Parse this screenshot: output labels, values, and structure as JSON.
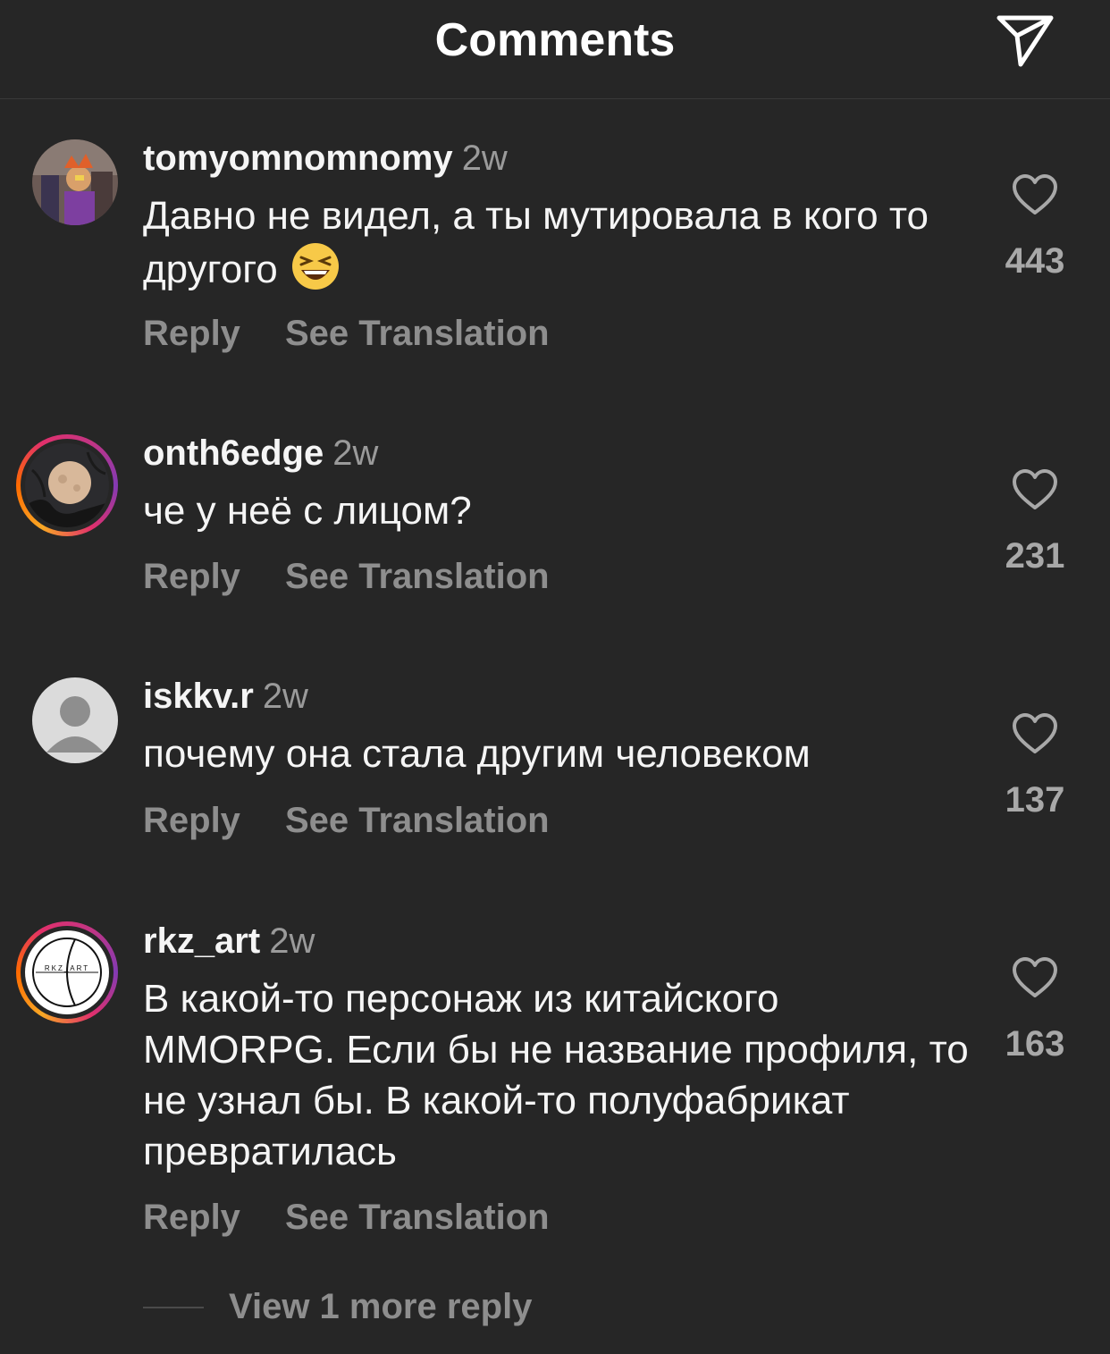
{
  "header": {
    "title": "Comments"
  },
  "comments": [
    {
      "username": "tomyomnomnomy",
      "time": "2w",
      "text": "Давно не видел, а ты мутировала в кого то другого",
      "emoji": "grinning-squinting-face",
      "reply_label": "Reply",
      "translate_label": "See Translation",
      "likes": "443",
      "avatar_ring": false
    },
    {
      "username": "onth6edge",
      "time": "2w",
      "text": "че у неё с лицом?",
      "reply_label": "Reply",
      "translate_label": "See Translation",
      "likes": "231",
      "avatar_ring": true
    },
    {
      "username": "iskkv.r",
      "time": "2w",
      "text": "почему она стала другим человеком",
      "reply_label": "Reply",
      "translate_label": "See Translation",
      "likes": "137",
      "avatar_ring": false
    },
    {
      "username": "rkz_art",
      "time": "2w",
      "text": "В какой-то персонаж из китайского MMORPG. Если бы не название профиля, то не узнал бы. В какой-то полуфабрикат превратилась",
      "reply_label": "Reply",
      "translate_label": "See Translation",
      "likes": "163",
      "avatar_ring": true,
      "avatar_logo_text": "RKZ_ART"
    }
  ],
  "view_more": {
    "label": "View 1 more reply"
  },
  "icons": {
    "share": "paper-plane-icon",
    "like": "heart-outline-icon"
  },
  "colors": {
    "background": "#262626",
    "muted": "#8e8e8e",
    "text": "#f5f5f5"
  }
}
